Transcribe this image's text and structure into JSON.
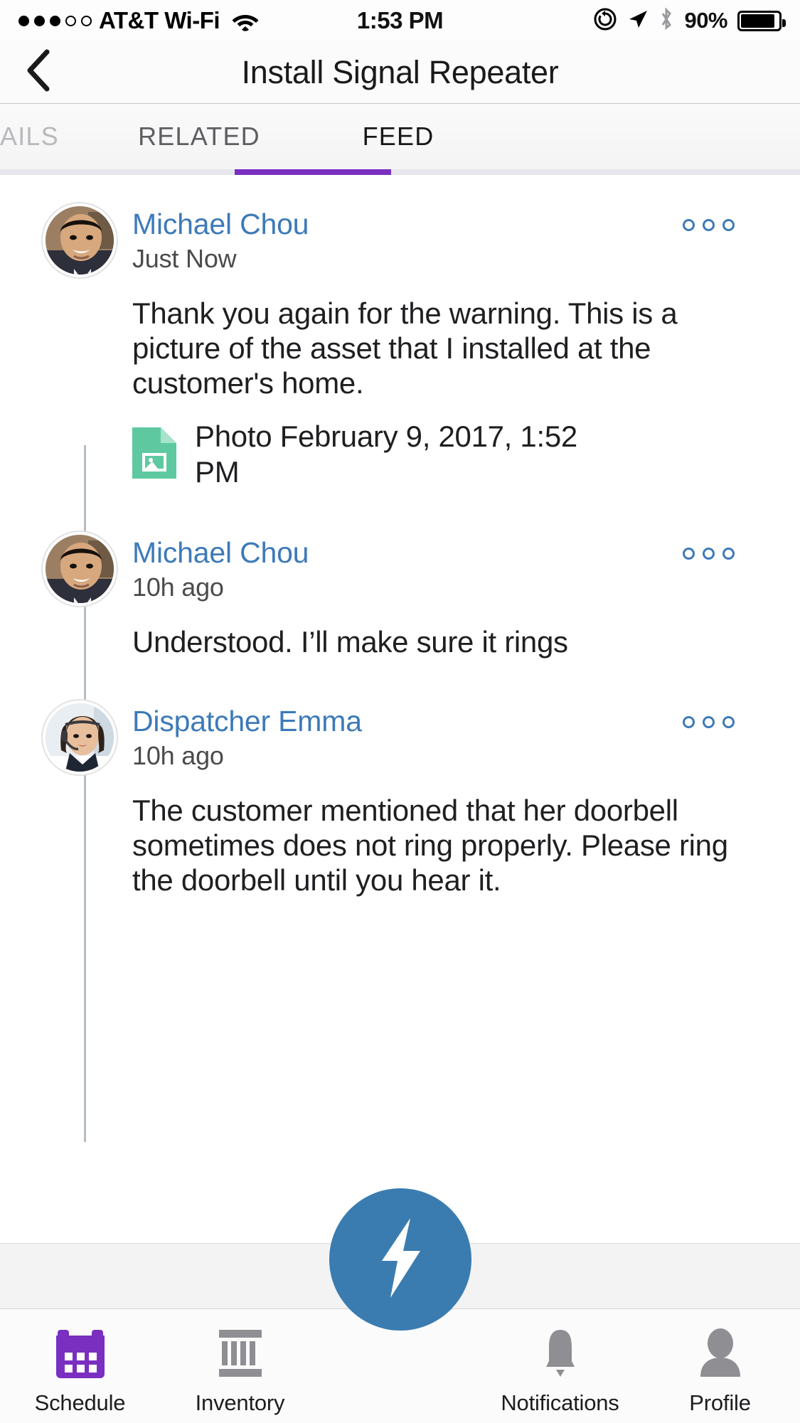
{
  "status_bar": {
    "signal_dots_filled": 3,
    "signal_dots_total": 5,
    "carrier": "AT&T Wi-Fi",
    "time": "1:53 PM",
    "battery_percent": "90%",
    "icons": [
      "wifi-icon",
      "rotation-lock-icon",
      "location-arrow-icon",
      "bluetooth-icon",
      "battery-icon"
    ]
  },
  "nav": {
    "back_icon": "chevron-left-icon",
    "title": "Install Signal Repeater"
  },
  "tabs": {
    "items": [
      {
        "label": "AILS",
        "active": false
      },
      {
        "label": "RELATED",
        "active": false
      },
      {
        "label": "FEED",
        "active": true
      }
    ],
    "active_color": "#7a2fc0"
  },
  "feed": {
    "posts": [
      {
        "author": "Michael Chou",
        "timestamp": "Just Now",
        "avatar": "photo-avatar-michael",
        "body": "Thank you again for the warning. This is a picture of the asset that I installed at the customer's home.",
        "menu_icon": "overflow-menu-icon",
        "attachment": {
          "icon": "image-file-icon",
          "icon_color": "#5ec9a1",
          "label": "Photo February 9, 2017, 1:52 PM"
        }
      },
      {
        "author": "Michael Chou",
        "timestamp": "10h ago",
        "avatar": "photo-avatar-michael",
        "body": "Understood. I’ll make sure it rings",
        "menu_icon": "overflow-menu-icon",
        "attachment": null
      },
      {
        "author": "Dispatcher Emma",
        "timestamp": "10h ago",
        "avatar": "photo-avatar-emma",
        "body": "The customer mentioned that her doorbell sometimes does not ring properly. Please ring the doorbell until you hear it.",
        "menu_icon": "overflow-menu-icon",
        "attachment": null
      }
    ]
  },
  "bottom_bar": {
    "items": [
      {
        "label": "Schedule",
        "icon": "calendar-icon",
        "active": true,
        "color": "#7a2fc0"
      },
      {
        "label": "Inventory",
        "icon": "inventory-icon",
        "active": false,
        "color": "#8e8e93"
      },
      {
        "label": "Notifications",
        "icon": "bell-icon",
        "active": false,
        "color": "#8e8e93"
      },
      {
        "label": "Profile",
        "icon": "person-icon",
        "active": false,
        "color": "#8e8e93"
      }
    ],
    "fab": {
      "icon": "lightning-bolt-icon",
      "color": "#3b7cb0"
    }
  },
  "colors": {
    "author_link": "#3d7ab8",
    "tab_accent": "#7a2fc0",
    "fab": "#3b7cb0",
    "attachment_green": "#5ec9a1"
  }
}
